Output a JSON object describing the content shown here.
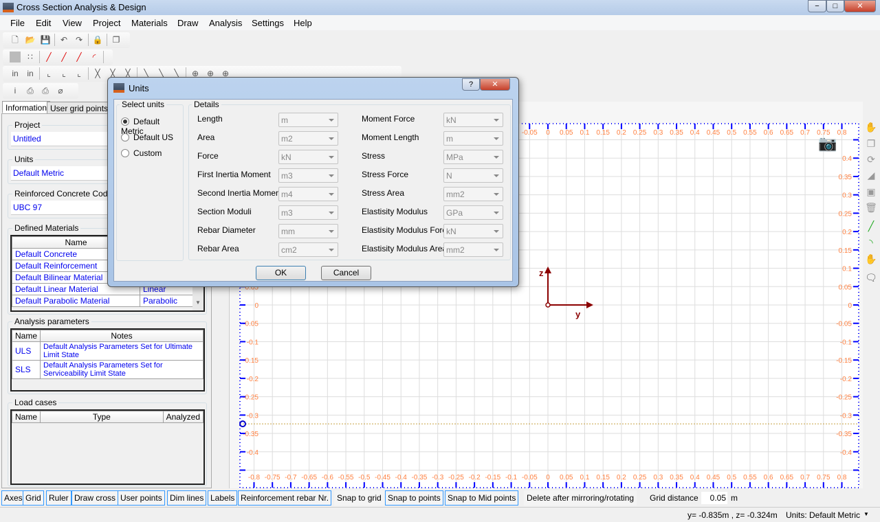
{
  "window": {
    "title": "Cross Section Analysis & Design",
    "min": "−",
    "max": "□",
    "close": "✕"
  },
  "menu": [
    "File",
    "Edit",
    "View",
    "Project",
    "Materials",
    "Draw",
    "Analysis",
    "Settings",
    "Help"
  ],
  "tabs": [
    "Information",
    "User grid points"
  ],
  "info": {
    "project_label": "Project",
    "project_value": "Untitled",
    "units_label": "Units",
    "units_value": "Default Metric",
    "code_label": "Reinforced Concrete Code",
    "code_value": "UBC 97",
    "materials_label": "Defined Materials",
    "materials_header": "Name",
    "materials": [
      {
        "name": "Default Concrete",
        "type": ""
      },
      {
        "name": "Default Reinforcement",
        "type": ""
      },
      {
        "name": "Default Bilinear Material",
        "type": ""
      },
      {
        "name": "Default Linear Material",
        "type": "Linear"
      },
      {
        "name": "Default Parabolic Material",
        "type": "Parabolic"
      }
    ],
    "analysis_label": "Analysis parameters",
    "analysis_headers": [
      "Name",
      "Notes"
    ],
    "analysis": [
      {
        "name": "ULS",
        "notes": "Default Analysis Parameters Set for Ultimate Limit State"
      },
      {
        "name": "SLS",
        "notes": "Default Analysis Parameters Set for Serviceability Limit State"
      }
    ],
    "loads_label": "Load cases",
    "loads_headers": [
      "Name",
      "Type",
      "Analyzed"
    ]
  },
  "dialog": {
    "title": "Units",
    "help": "?",
    "close": "✕",
    "select_label": "Select units",
    "options": [
      {
        "label": "Default Metric",
        "checked": true
      },
      {
        "label": "Default US",
        "checked": false
      },
      {
        "label": "Custom",
        "checked": false
      }
    ],
    "details_label": "Details",
    "left": [
      {
        "label": "Length",
        "value": "m"
      },
      {
        "label": "Area",
        "value": "m2"
      },
      {
        "label": "Force",
        "value": "kN"
      },
      {
        "label": "First Inertia Moment",
        "value": "m3"
      },
      {
        "label": "Second Inertia Moment",
        "value": "m4"
      },
      {
        "label": "Section Moduli",
        "value": "m3"
      },
      {
        "label": "Rebar Diameter",
        "value": "mm"
      },
      {
        "label": "Rebar Area",
        "value": "cm2"
      }
    ],
    "right": [
      {
        "label": "Moment Force",
        "value": "kN"
      },
      {
        "label": "Moment Length",
        "value": "m"
      },
      {
        "label": "Stress",
        "value": "MPa"
      },
      {
        "label": "Stress Force",
        "value": "N"
      },
      {
        "label": "Stress Area",
        "value": "mm2"
      },
      {
        "label": "Elastisity Modulus",
        "value": "GPa"
      },
      {
        "label": "Elastisity Modulus Force",
        "value": "kN"
      },
      {
        "label": "Elastisity Modulus Area",
        "value": "mm2"
      }
    ],
    "ok": "OK",
    "cancel": "Cancel"
  },
  "canvas": {
    "x_min": -0.8,
    "x_max": 0.8,
    "y_min": -0.4,
    "y_max": 0.4,
    "step": 0.05,
    "axis_y_label": "y",
    "axis_z_label": "z",
    "cursor_z": -0.324,
    "label_color": "#ff8040",
    "ruler_color": "#0000ff",
    "axis_color": "#8b0000"
  },
  "bottom_toggles": [
    {
      "label": "Axes",
      "on": true
    },
    {
      "label": "Grid",
      "on": true
    },
    {
      "label": "Ruler",
      "on": true
    },
    {
      "label": "Draw cross",
      "on": true
    },
    {
      "label": "User points",
      "on": true
    },
    {
      "label": "Dim lines",
      "on": true
    },
    {
      "label": "Labels",
      "on": true
    },
    {
      "label": "Reinforcement rebar Nr.",
      "on": true
    },
    {
      "label": "Snap to grid",
      "on": false
    },
    {
      "label": "Snap to points",
      "on": true
    },
    {
      "label": "Snap to Mid points",
      "on": true
    },
    {
      "label": "Delete after mirroring/rotating",
      "on": false
    }
  ],
  "grid_distance": {
    "label": "Grid distance",
    "value": "0.05",
    "unit": "m"
  },
  "status": {
    "coords": "y= -0.835m , z= -0.324m",
    "units": "Units: Default Metric"
  }
}
